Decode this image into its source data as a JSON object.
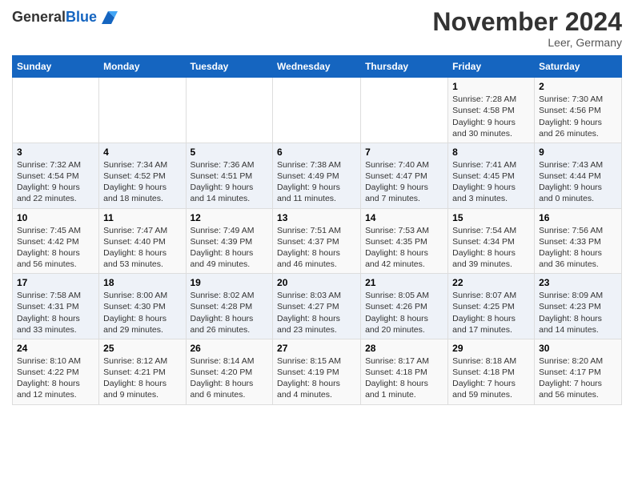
{
  "logo": {
    "general": "General",
    "blue": "Blue"
  },
  "title": "November 2024",
  "location": "Leer, Germany",
  "days_of_week": [
    "Sunday",
    "Monday",
    "Tuesday",
    "Wednesday",
    "Thursday",
    "Friday",
    "Saturday"
  ],
  "weeks": [
    [
      {
        "day": "",
        "info": ""
      },
      {
        "day": "",
        "info": ""
      },
      {
        "day": "",
        "info": ""
      },
      {
        "day": "",
        "info": ""
      },
      {
        "day": "",
        "info": ""
      },
      {
        "day": "1",
        "info": "Sunrise: 7:28 AM\nSunset: 4:58 PM\nDaylight: 9 hours\nand 30 minutes."
      },
      {
        "day": "2",
        "info": "Sunrise: 7:30 AM\nSunset: 4:56 PM\nDaylight: 9 hours\nand 26 minutes."
      }
    ],
    [
      {
        "day": "3",
        "info": "Sunrise: 7:32 AM\nSunset: 4:54 PM\nDaylight: 9 hours\nand 22 minutes."
      },
      {
        "day": "4",
        "info": "Sunrise: 7:34 AM\nSunset: 4:52 PM\nDaylight: 9 hours\nand 18 minutes."
      },
      {
        "day": "5",
        "info": "Sunrise: 7:36 AM\nSunset: 4:51 PM\nDaylight: 9 hours\nand 14 minutes."
      },
      {
        "day": "6",
        "info": "Sunrise: 7:38 AM\nSunset: 4:49 PM\nDaylight: 9 hours\nand 11 minutes."
      },
      {
        "day": "7",
        "info": "Sunrise: 7:40 AM\nSunset: 4:47 PM\nDaylight: 9 hours\nand 7 minutes."
      },
      {
        "day": "8",
        "info": "Sunrise: 7:41 AM\nSunset: 4:45 PM\nDaylight: 9 hours\nand 3 minutes."
      },
      {
        "day": "9",
        "info": "Sunrise: 7:43 AM\nSunset: 4:44 PM\nDaylight: 9 hours\nand 0 minutes."
      }
    ],
    [
      {
        "day": "10",
        "info": "Sunrise: 7:45 AM\nSunset: 4:42 PM\nDaylight: 8 hours\nand 56 minutes."
      },
      {
        "day": "11",
        "info": "Sunrise: 7:47 AM\nSunset: 4:40 PM\nDaylight: 8 hours\nand 53 minutes."
      },
      {
        "day": "12",
        "info": "Sunrise: 7:49 AM\nSunset: 4:39 PM\nDaylight: 8 hours\nand 49 minutes."
      },
      {
        "day": "13",
        "info": "Sunrise: 7:51 AM\nSunset: 4:37 PM\nDaylight: 8 hours\nand 46 minutes."
      },
      {
        "day": "14",
        "info": "Sunrise: 7:53 AM\nSunset: 4:35 PM\nDaylight: 8 hours\nand 42 minutes."
      },
      {
        "day": "15",
        "info": "Sunrise: 7:54 AM\nSunset: 4:34 PM\nDaylight: 8 hours\nand 39 minutes."
      },
      {
        "day": "16",
        "info": "Sunrise: 7:56 AM\nSunset: 4:33 PM\nDaylight: 8 hours\nand 36 minutes."
      }
    ],
    [
      {
        "day": "17",
        "info": "Sunrise: 7:58 AM\nSunset: 4:31 PM\nDaylight: 8 hours\nand 33 minutes."
      },
      {
        "day": "18",
        "info": "Sunrise: 8:00 AM\nSunset: 4:30 PM\nDaylight: 8 hours\nand 29 minutes."
      },
      {
        "day": "19",
        "info": "Sunrise: 8:02 AM\nSunset: 4:28 PM\nDaylight: 8 hours\nand 26 minutes."
      },
      {
        "day": "20",
        "info": "Sunrise: 8:03 AM\nSunset: 4:27 PM\nDaylight: 8 hours\nand 23 minutes."
      },
      {
        "day": "21",
        "info": "Sunrise: 8:05 AM\nSunset: 4:26 PM\nDaylight: 8 hours\nand 20 minutes."
      },
      {
        "day": "22",
        "info": "Sunrise: 8:07 AM\nSunset: 4:25 PM\nDaylight: 8 hours\nand 17 minutes."
      },
      {
        "day": "23",
        "info": "Sunrise: 8:09 AM\nSunset: 4:23 PM\nDaylight: 8 hours\nand 14 minutes."
      }
    ],
    [
      {
        "day": "24",
        "info": "Sunrise: 8:10 AM\nSunset: 4:22 PM\nDaylight: 8 hours\nand 12 minutes."
      },
      {
        "day": "25",
        "info": "Sunrise: 8:12 AM\nSunset: 4:21 PM\nDaylight: 8 hours\nand 9 minutes."
      },
      {
        "day": "26",
        "info": "Sunrise: 8:14 AM\nSunset: 4:20 PM\nDaylight: 8 hours\nand 6 minutes."
      },
      {
        "day": "27",
        "info": "Sunrise: 8:15 AM\nSunset: 4:19 PM\nDaylight: 8 hours\nand 4 minutes."
      },
      {
        "day": "28",
        "info": "Sunrise: 8:17 AM\nSunset: 4:18 PM\nDaylight: 8 hours\nand 1 minute."
      },
      {
        "day": "29",
        "info": "Sunrise: 8:18 AM\nSunset: 4:18 PM\nDaylight: 7 hours\nand 59 minutes."
      },
      {
        "day": "30",
        "info": "Sunrise: 8:20 AM\nSunset: 4:17 PM\nDaylight: 7 hours\nand 56 minutes."
      }
    ]
  ]
}
